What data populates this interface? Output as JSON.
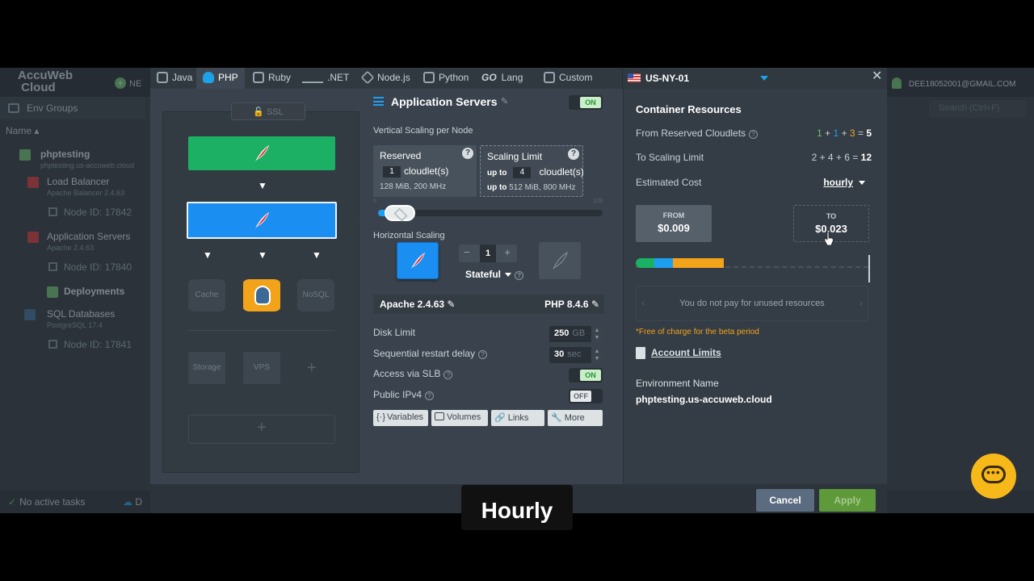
{
  "background": {
    "logo": "AccuWeb Cloud",
    "new_label": "NE",
    "env_groups": "Env Groups",
    "name_header": "Name",
    "search_placeholder": "Search (Ctrl+F)",
    "user_email": "DEE18052001@GMAIL.COM",
    "tasks": "No active tasks",
    "bottom_tab": "D",
    "tree": {
      "env": {
        "name": "phptesting",
        "domain": "phptesting.us-accuweb.cloud"
      },
      "lb": {
        "name": "Load Balancer",
        "sub": "Apache Balancer 2.4.63",
        "node": "Node ID: 17842"
      },
      "app": {
        "name": "Application Servers",
        "sub": "Apache 2.4.63",
        "node": "Node ID: 17840"
      },
      "deployments": "Deployments",
      "sql": {
        "name": "SQL Databases",
        "sub": "PostgreSQL 17.4",
        "node": "Node ID: 17841"
      }
    }
  },
  "tabs": [
    {
      "label": "Java"
    },
    {
      "label": "PHP"
    },
    {
      "label": "Ruby"
    },
    {
      "label": ".NET"
    },
    {
      "label": "Node.js"
    },
    {
      "label": "Python"
    },
    {
      "label": "Lang"
    },
    {
      "label": "Custom"
    }
  ],
  "go_logo": "GO",
  "region": "US-NY-01",
  "topology": {
    "ssl": "SSL",
    "cache": "Cache",
    "nosql": "NoSQL",
    "storage": "Storage",
    "vps": "VPS"
  },
  "config": {
    "title": "Application Servers",
    "on": "ON",
    "off": "OFF",
    "vertical_label": "Vertical Scaling per Node",
    "reserved": {
      "title": "Reserved",
      "value": "1",
      "unit": "cloudlet(s)",
      "spec": "128 MiB, 200 MHz"
    },
    "limit": {
      "title": "Scaling Limit",
      "up_to": "up to",
      "value": "4",
      "unit": "cloudlet(s)",
      "spec_prefix": "up to",
      "spec": "512 MiB, 800 MHz"
    },
    "slider": {
      "min_mark": "0",
      "max_mark": "128",
      "value": 1,
      "max": 128
    },
    "horizontal_label": "Horizontal Scaling",
    "node_count": "1",
    "stateful": "Stateful",
    "apache": "Apache 2.4.63",
    "php": "PHP 8.4.6",
    "disk_label": "Disk Limit",
    "disk_value": "250",
    "disk_unit": "GB",
    "restart_label": "Sequential restart delay",
    "restart_value": "30",
    "restart_unit": "sec",
    "slb_label": "Access via SLB",
    "ipv4_label": "Public IPv4",
    "buttons": [
      "Variables",
      "Volumes",
      "Links",
      "More"
    ]
  },
  "resources": {
    "title": "Container Resources",
    "from_label": "From Reserved Cloudlets",
    "to_label": "To Scaling Limit",
    "from_parts": [
      "1",
      "+",
      "1",
      "+",
      "3",
      "=",
      "5"
    ],
    "to_formula": "2 + 4 + 6 =",
    "to_total": "12",
    "cost_label": "Estimated Cost",
    "period": "hourly",
    "from_k": "FROM",
    "from_v": "$0.009",
    "to_k": "TO",
    "to_v": "$0.023",
    "unused": "You do not pay for unused resources",
    "beta": "*Free of charge for the beta period",
    "account": "Account Limits",
    "env_label": "Environment Name",
    "env_value": "phptesting.us-accuweb.cloud",
    "bar": [
      {
        "share": 0.08,
        "color": "#1bb063"
      },
      {
        "share": 0.08,
        "color": "#1d9ff1"
      },
      {
        "share": 0.22,
        "color": "#f3a31a"
      }
    ]
  },
  "footer": {
    "cancel": "Cancel",
    "apply": "Apply"
  },
  "caption": "Hourly"
}
